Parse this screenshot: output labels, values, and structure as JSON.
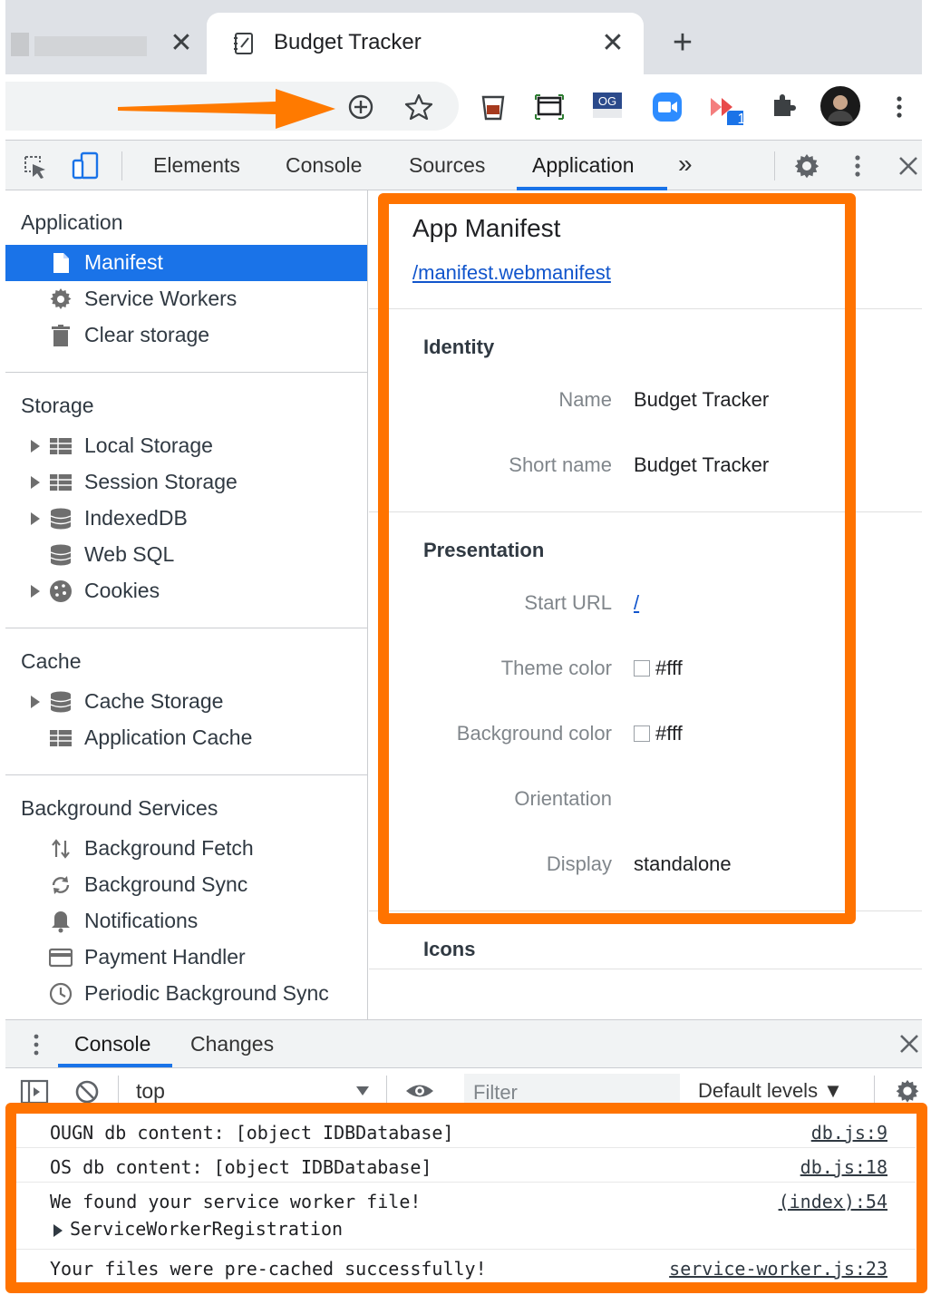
{
  "browser": {
    "tab_title": "Budget Tracker",
    "close_glyph": "✕",
    "new_tab_glyph": "+",
    "toolbar_icons": [
      "install-icon",
      "bookmark-star-icon",
      "extension-cup-icon",
      "screenshot-icon",
      "og-extension-icon",
      "zoom-extension-icon",
      "extension-badge-icon",
      "extensions-puzzle-icon",
      "profile-avatar",
      "more-menu-icon"
    ],
    "og_label": "OG",
    "badge_count": "1"
  },
  "devtools": {
    "tabs": [
      "Elements",
      "Console",
      "Sources",
      "Application"
    ],
    "overflow_glyph": "»",
    "active_tab": "Application",
    "accent_color": "#1a73e8"
  },
  "sidebar": {
    "application": {
      "heading": "Application",
      "items": [
        "Manifest",
        "Service Workers",
        "Clear storage"
      ]
    },
    "storage": {
      "heading": "Storage",
      "items": [
        "Local Storage",
        "Session Storage",
        "IndexedDB",
        "Web SQL",
        "Cookies"
      ]
    },
    "cache": {
      "heading": "Cache",
      "items": [
        "Cache Storage",
        "Application Cache"
      ]
    },
    "background": {
      "heading": "Background Services",
      "items": [
        "Background Fetch",
        "Background Sync",
        "Notifications",
        "Payment Handler",
        "Periodic Background Sync"
      ]
    }
  },
  "manifest": {
    "title": "App Manifest",
    "link": "/manifest.webmanifest",
    "identity": {
      "heading": "Identity",
      "name_label": "Name",
      "name_value": "Budget Tracker",
      "short_name_label": "Short name",
      "short_name_value": "Budget Tracker"
    },
    "presentation": {
      "heading": "Presentation",
      "start_url_label": "Start URL",
      "start_url_value": "/",
      "theme_color_label": "Theme color",
      "theme_color_value": "#fff",
      "bg_color_label": "Background color",
      "bg_color_value": "#fff",
      "orientation_label": "Orientation",
      "orientation_value": "",
      "display_label": "Display",
      "display_value": "standalone"
    },
    "icons_heading": "Icons"
  },
  "drawer": {
    "tabs": [
      "Console",
      "Changes"
    ],
    "context": "top",
    "filter_placeholder": "Filter",
    "levels": "Default levels ▼"
  },
  "console": {
    "messages": [
      {
        "text": "OUGN db content: [object IDBDatabase]",
        "source": "db.js:9"
      },
      {
        "text": "OS db content: [object IDBDatabase]",
        "source": "db.js:18"
      },
      {
        "text": "We found your service worker file!",
        "detail": "ServiceWorkerRegistration",
        "source": "(index):54"
      },
      {
        "text": "Your files were pre-cached successfully!",
        "source": "service-worker.js:23"
      }
    ]
  },
  "highlight_color": "#ff7300"
}
